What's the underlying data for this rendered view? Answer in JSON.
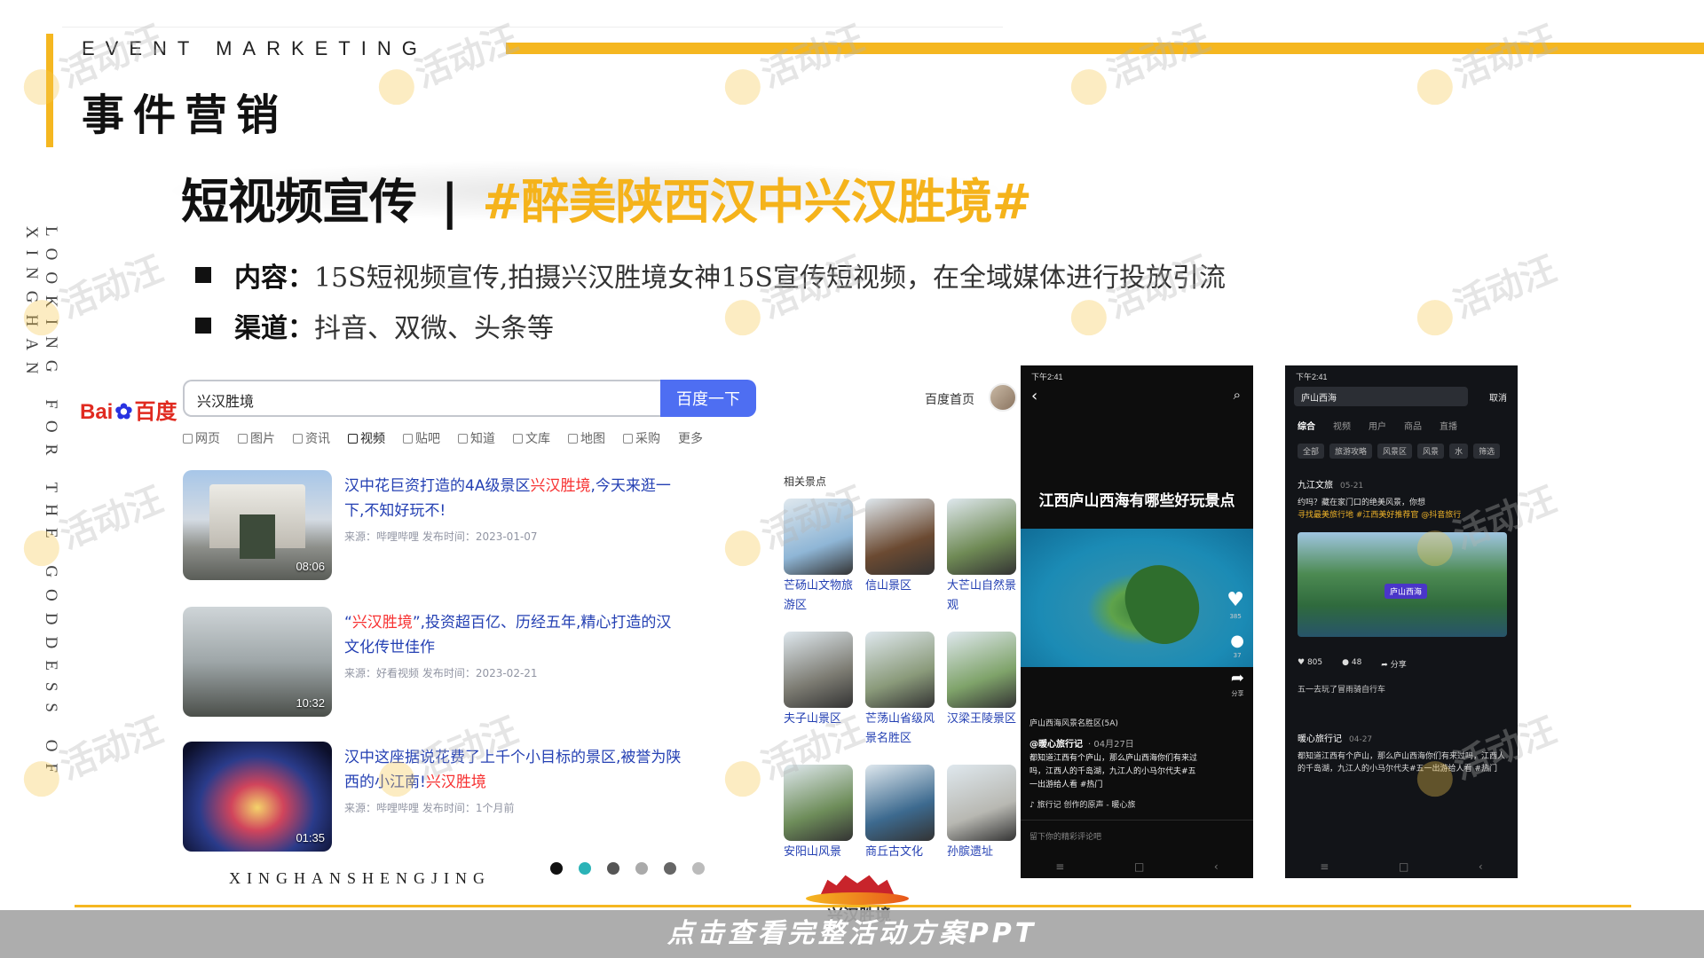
{
  "header": {
    "en_title": "EVENT MARKETING",
    "cn_title": "事件营销",
    "vertical_text": "LOOKING FOR THE GODDESS OF XINGHAN"
  },
  "title": {
    "prefix": "短视频宣传",
    "separator": "|",
    "hashtag": "#醉美陕西汉中兴汉胜境#"
  },
  "bullets": [
    {
      "label": "内容：",
      "text": "15S短视频宣传,拍摄兴汉胜境女神15S宣传短视频，在全域媒体进行投放引流"
    },
    {
      "label": "渠道：",
      "text": "抖音、双微、头条等"
    }
  ],
  "baidu": {
    "logo_left": "Bai",
    "logo_paw": "✿",
    "logo_right": "百度",
    "search_value": "兴汉胜境",
    "search_button": "百度一下",
    "home_link": "百度首页",
    "tabs": [
      "网页",
      "图片",
      "资讯",
      "视频",
      "贴吧",
      "知道",
      "文库",
      "地图",
      "采购",
      "更多"
    ],
    "results": [
      {
        "title_a": "汉中花巨资打造的4A级景区",
        "title_hl": "兴汉胜境",
        "title_b": ",今天来逛一下,不知好玩不!",
        "meta": "来源：哔哩哔哩   发布时间：2023-01-07",
        "duration": "08:06"
      },
      {
        "title_a": "“",
        "title_hl": "兴汉胜境",
        "title_b": "”,投资超百亿、历经五年,精心打造的汉文化传世佳作",
        "meta": "来源：好看视频   发布时间：2023-02-21",
        "duration": "10:32"
      },
      {
        "title_a": "汉中这座据说花费了上千个小目标的景区,被誉为陕西的小江南!",
        "title_hl": "兴汉胜境",
        "title_b": "",
        "meta": "来源：哔哩哔哩   发布时间：1个月前",
        "duration": "01:35"
      }
    ],
    "related_title": "相关景点",
    "related": [
      {
        "name": "芒砀山文物旅游区",
        "color": "#8fb6d6"
      },
      {
        "name": "信山景区",
        "color": "#6b4a32"
      },
      {
        "name": "大芒山自然景观",
        "color": "#6f8a55"
      },
      {
        "name": "夫子山景区",
        "color": "#7c7b72"
      },
      {
        "name": "芒荡山省级风景名胜区",
        "color": "#8a9a7a"
      },
      {
        "name": "汉梁王陵景区",
        "color": "#7fa36a"
      },
      {
        "name": "安阳山风景",
        "color": "#6e8d5a"
      },
      {
        "name": "商丘古文化",
        "color": "#3d6a8f"
      },
      {
        "name": "孙膑遗址",
        "color": "#b8b8b2"
      }
    ]
  },
  "phone1": {
    "status": "下午2:41",
    "caption": "江西庐山西海有哪些好玩景点",
    "poi": "庐山西海风景名胜区(5A)",
    "author": "@暖心旅行记",
    "date": "· 04月27日",
    "text": "都知道江西有个庐山，那么庐山西海你们有来过吗，江西人的千岛湖，九江人的小马尔代夫#五一出游给人看 #热门",
    "music": "♪ 旅行记 创作的原声 - 暖心旅",
    "likes": "385",
    "comments": "37",
    "share": "分享",
    "comment_hint": "留下你的精彩评论吧"
  },
  "phone2": {
    "status": "下午2:41",
    "search_value": "庐山西海",
    "cancel": "取消",
    "tabs": [
      "综合",
      "视频",
      "用户",
      "商品",
      "直播"
    ],
    "chips": [
      "全部",
      "旅游攻略",
      "风景区",
      "风景",
      "水",
      "筛选"
    ],
    "account": "九江文旅",
    "account_time": "05-21",
    "desc": "约吗？藏在家门口的绝美风景，你想",
    "tag": "寻找最美旅行地 #江西美好推荐官 @抖音旅行",
    "video_label": "庐山西海",
    "likes": "805",
    "comments": "48",
    "share": "分享",
    "comment": "五一去玩了冒雨骑自行车",
    "account2": "暖心旅行记",
    "account2_time": "04-27",
    "desc2": "都知道江西有个庐山，那么庐山西海你们有来过吗，江西人的千岛湖，九江人的小马尔代夫#五一出游给人看 #热门"
  },
  "footer": {
    "pinyin": "XINGHANSHENGJING",
    "logo_text": "兴汉胜境",
    "cta": "点击查看完整活动方案PPT"
  },
  "watermark": "活动汪",
  "colors": {
    "accent": "#f5b720",
    "hashtag": "#f5b31b",
    "baidu_blue": "#4e6ef2",
    "highlight_red": "#f73131"
  }
}
